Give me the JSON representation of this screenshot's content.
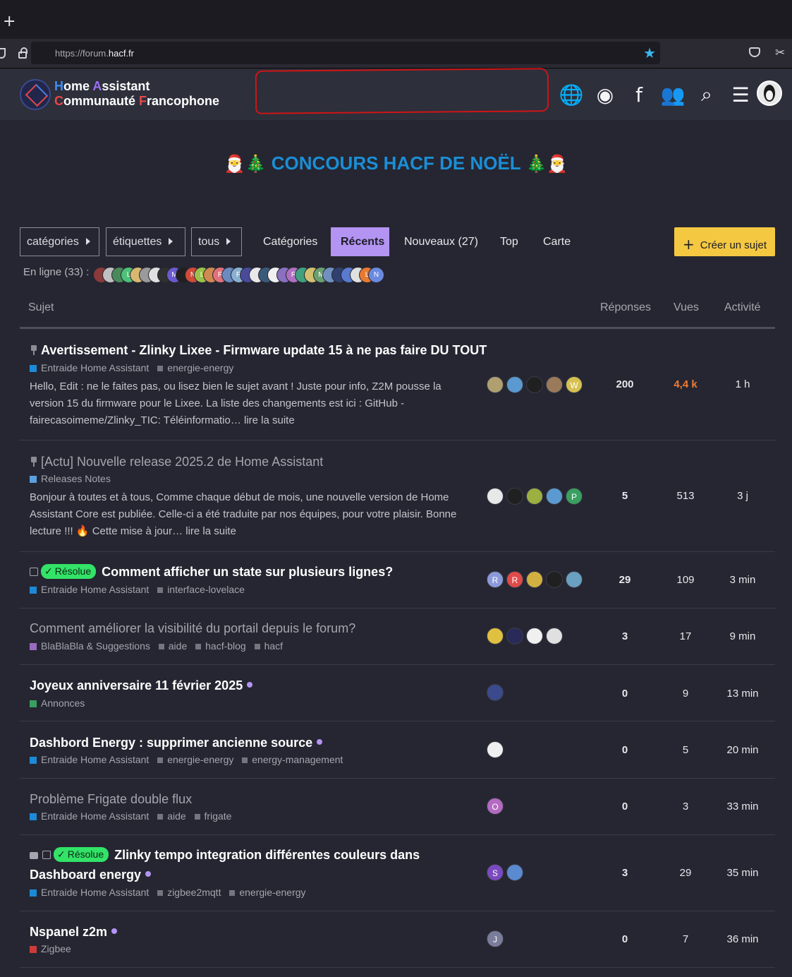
{
  "browser": {
    "new_tab": "+",
    "url_prefix": "https://forum.",
    "url_domain": "hacf.fr"
  },
  "site": {
    "logo_line1_a": "H",
    "logo_line1_b": "ome ",
    "logo_line1_c": "A",
    "logo_line1_d": "ssistant",
    "logo_line2_a": "C",
    "logo_line2_b": "ommunauté ",
    "logo_line2_c": "F",
    "logo_line2_d": "rancophone",
    "icons": [
      "globe-icon",
      "discord-icon",
      "facebook-icon",
      "users-icon",
      "search-icon",
      "menu-icon"
    ],
    "icon_glyphs": [
      "🌐",
      "◉",
      "f",
      "👥",
      "⌕",
      "☰"
    ]
  },
  "banner": {
    "emoji_left": "🎅🎄",
    "text": "CONCOURS HACF DE NOËL",
    "emoji_right": "🎄🎅"
  },
  "nav": {
    "categories_dd": "catégories",
    "tags_dd": "étiquettes",
    "all_dd": "tous",
    "links": [
      "Catégories",
      "Récents",
      "Nouveaux (27)",
      "Top",
      "Carte"
    ],
    "create_label": "Créer un sujet",
    "online_label": "En ligne (33) :"
  },
  "online_avatars": [
    {
      "l": "",
      "c": "#8a3a3a"
    },
    {
      "l": "",
      "c": "#c0c0c0"
    },
    {
      "l": "",
      "c": "#4a8a5a"
    },
    {
      "l": "L",
      "c": "#4fc07a"
    },
    {
      "l": "",
      "c": "#d8b870"
    },
    {
      "l": "",
      "c": "#9a9a9a"
    },
    {
      "l": "",
      "c": "#e0e0e0"
    },
    {
      "l": "",
      "c": "#303030"
    },
    {
      "l": "M",
      "c": "#6a5acd"
    },
    {
      "l": "",
      "c": "#202020"
    },
    {
      "l": "N",
      "c": "#d24a3a"
    },
    {
      "l": "L",
      "c": "#9ac24a"
    },
    {
      "l": "",
      "c": "#d08a50"
    },
    {
      "l": "R",
      "c": "#e0707a"
    },
    {
      "l": "",
      "c": "#6a8ac0"
    },
    {
      "l": "R",
      "c": "#8ab0d0"
    },
    {
      "l": "",
      "c": "#4a4a9a"
    },
    {
      "l": "",
      "c": "#e8e8e8"
    },
    {
      "l": "",
      "c": "#3a5a7a"
    },
    {
      "l": "",
      "c": "#f0f0f0"
    },
    {
      "l": "",
      "c": "#8a70c0"
    },
    {
      "l": "R",
      "c": "#b070c0"
    },
    {
      "l": "",
      "c": "#40a080"
    },
    {
      "l": "",
      "c": "#d0c070"
    },
    {
      "l": "M",
      "c": "#6aa070"
    },
    {
      "l": "",
      "c": "#7090c0"
    },
    {
      "l": "",
      "c": "#304070"
    },
    {
      "l": "",
      "c": "#5a7ad0"
    },
    {
      "l": "",
      "c": "#e0e0e0"
    },
    {
      "l": "L",
      "c": "#e87a30"
    },
    {
      "l": "N",
      "c": "#6a8ae0"
    }
  ],
  "table": {
    "col_topic": "Sujet",
    "col_replies": "Réponses",
    "col_views": "Vues",
    "col_activity": "Activité"
  },
  "topics": [
    {
      "title": "Avertissement - Zlinky Lixee - Firmware update 15 à ne pas faire DU TOUT",
      "category": "Entraide Home Assistant",
      "cat_color": "#1d8ad8",
      "tags": [
        "energie-energy"
      ],
      "excerpt": "Hello, Edit : ne le faites pas, ou lisez bien le sujet avant ! Juste pour info, Z2M pousse la version 15 du firmware pour le Lixee. La liste des changements est ici : GitHub - fairecasoimeme/Zlinky_TIC: Téléinformatio… lire la suite",
      "avatars": [
        {
          "l": "",
          "c": "#b0a070"
        },
        {
          "l": "",
          "c": "#5a9ad0"
        },
        {
          "l": "",
          "c": "#202020"
        },
        {
          "l": "",
          "c": "#9a7a5a"
        },
        {
          "l": "W",
          "c": "#d6c050"
        }
      ],
      "replies": "200",
      "views": "4,4 k",
      "activity": "1 h"
    },
    {
      "title": "[Actu] Nouvelle release 2025.2 de Home Assistant",
      "category": "Releases Notes",
      "cat_color": "#5aa0e0",
      "tags": [],
      "excerpt": "Bonjour à toutes et à tous, Comme chaque début de mois, une nouvelle version de Home Assistant Core est publiée. Celle-ci a été traduite par nos équipes, pour votre plaisir. Bonne lecture !!! 🔥 Cette mise à jour… lire la suite",
      "avatars": [
        {
          "l": "",
          "c": "#e8e8e8"
        },
        {
          "l": "",
          "c": "#202020"
        },
        {
          "l": "",
          "c": "#9ab040"
        },
        {
          "l": "",
          "c": "#5a9ad0"
        },
        {
          "l": "P",
          "c": "#3aa060"
        }
      ],
      "replies": "5",
      "views": "513",
      "activity": "3 j"
    },
    {
      "resolved_label": "Résolue",
      "title": "Comment afficher un state sur plusieurs lignes?",
      "category": "Entraide Home Assistant",
      "cat_color": "#1d8ad8",
      "tags": [
        "interface-lovelace"
      ],
      "avatars": [
        {
          "l": "R",
          "c": "#8a9ad8"
        },
        {
          "l": "R",
          "c": "#e04a4a"
        },
        {
          "l": "",
          "c": "#d0b040"
        },
        {
          "l": "",
          "c": "#202020"
        },
        {
          "l": "",
          "c": "#6aa0c0"
        }
      ],
      "replies": "29",
      "views": "109",
      "activity": "3 min"
    },
    {
      "title": "Comment améliorer la visibilité du portail depuis le forum?",
      "category": "BlaBlaBla & Suggestions",
      "cat_color": "#9a6ac0",
      "tags": [
        "aide",
        "hacf-blog",
        "hacf"
      ],
      "avatars": [
        {
          "l": "",
          "c": "#e0c040"
        },
        {
          "l": "",
          "c": "#2a2a5a"
        },
        {
          "l": "",
          "c": "#f0f0f0"
        },
        {
          "l": "",
          "c": "#e0e0e0"
        }
      ],
      "replies": "3",
      "views": "17",
      "activity": "9 min"
    },
    {
      "title": "Joyeux anniversaire 11 février 2025",
      "category": "Annonces",
      "cat_color": "#3aa060",
      "tags": [],
      "avatars": [
        {
          "l": "",
          "c": "#3a4a8c"
        }
      ],
      "replies": "0",
      "views": "9",
      "activity": "13 min"
    },
    {
      "title": "Dashbord Energy : supprimer ancienne source",
      "category": "Entraide Home Assistant",
      "cat_color": "#1d8ad8",
      "tags": [
        "energie-energy",
        "energy-management"
      ],
      "avatars": [
        {
          "l": "",
          "c": "#f0f0f0"
        }
      ],
      "replies": "0",
      "views": "5",
      "activity": "20 min"
    },
    {
      "title": "Problème Frigate double flux",
      "category": "Entraide Home Assistant",
      "cat_color": "#1d8ad8",
      "tags": [
        "aide",
        "frigate"
      ],
      "avatars": [
        {
          "l": "O",
          "c": "#b46ac0"
        }
      ],
      "replies": "0",
      "views": "3",
      "activity": "33 min"
    },
    {
      "resolved_label": "Résolue",
      "title_line1": "Zlinky tempo integration différentes couleurs dans",
      "title_line2": "Dashboard energy",
      "category": "Entraide Home Assistant",
      "cat_color": "#1d8ad8",
      "tags": [
        "zigbee2mqtt",
        "energie-energy"
      ],
      "avatars": [
        {
          "l": "S",
          "c": "#7a4ac0"
        },
        {
          "l": "",
          "c": "#5a8ad0"
        }
      ],
      "replies": "3",
      "views": "29",
      "activity": "35 min"
    },
    {
      "title": "Nspanel z2m",
      "category": "Zigbee",
      "cat_color": "#d03a3a",
      "tags": [],
      "avatars": [
        {
          "l": "J",
          "c": "#7a7d9a"
        }
      ],
      "replies": "0",
      "views": "7",
      "activity": "36 min"
    }
  ]
}
